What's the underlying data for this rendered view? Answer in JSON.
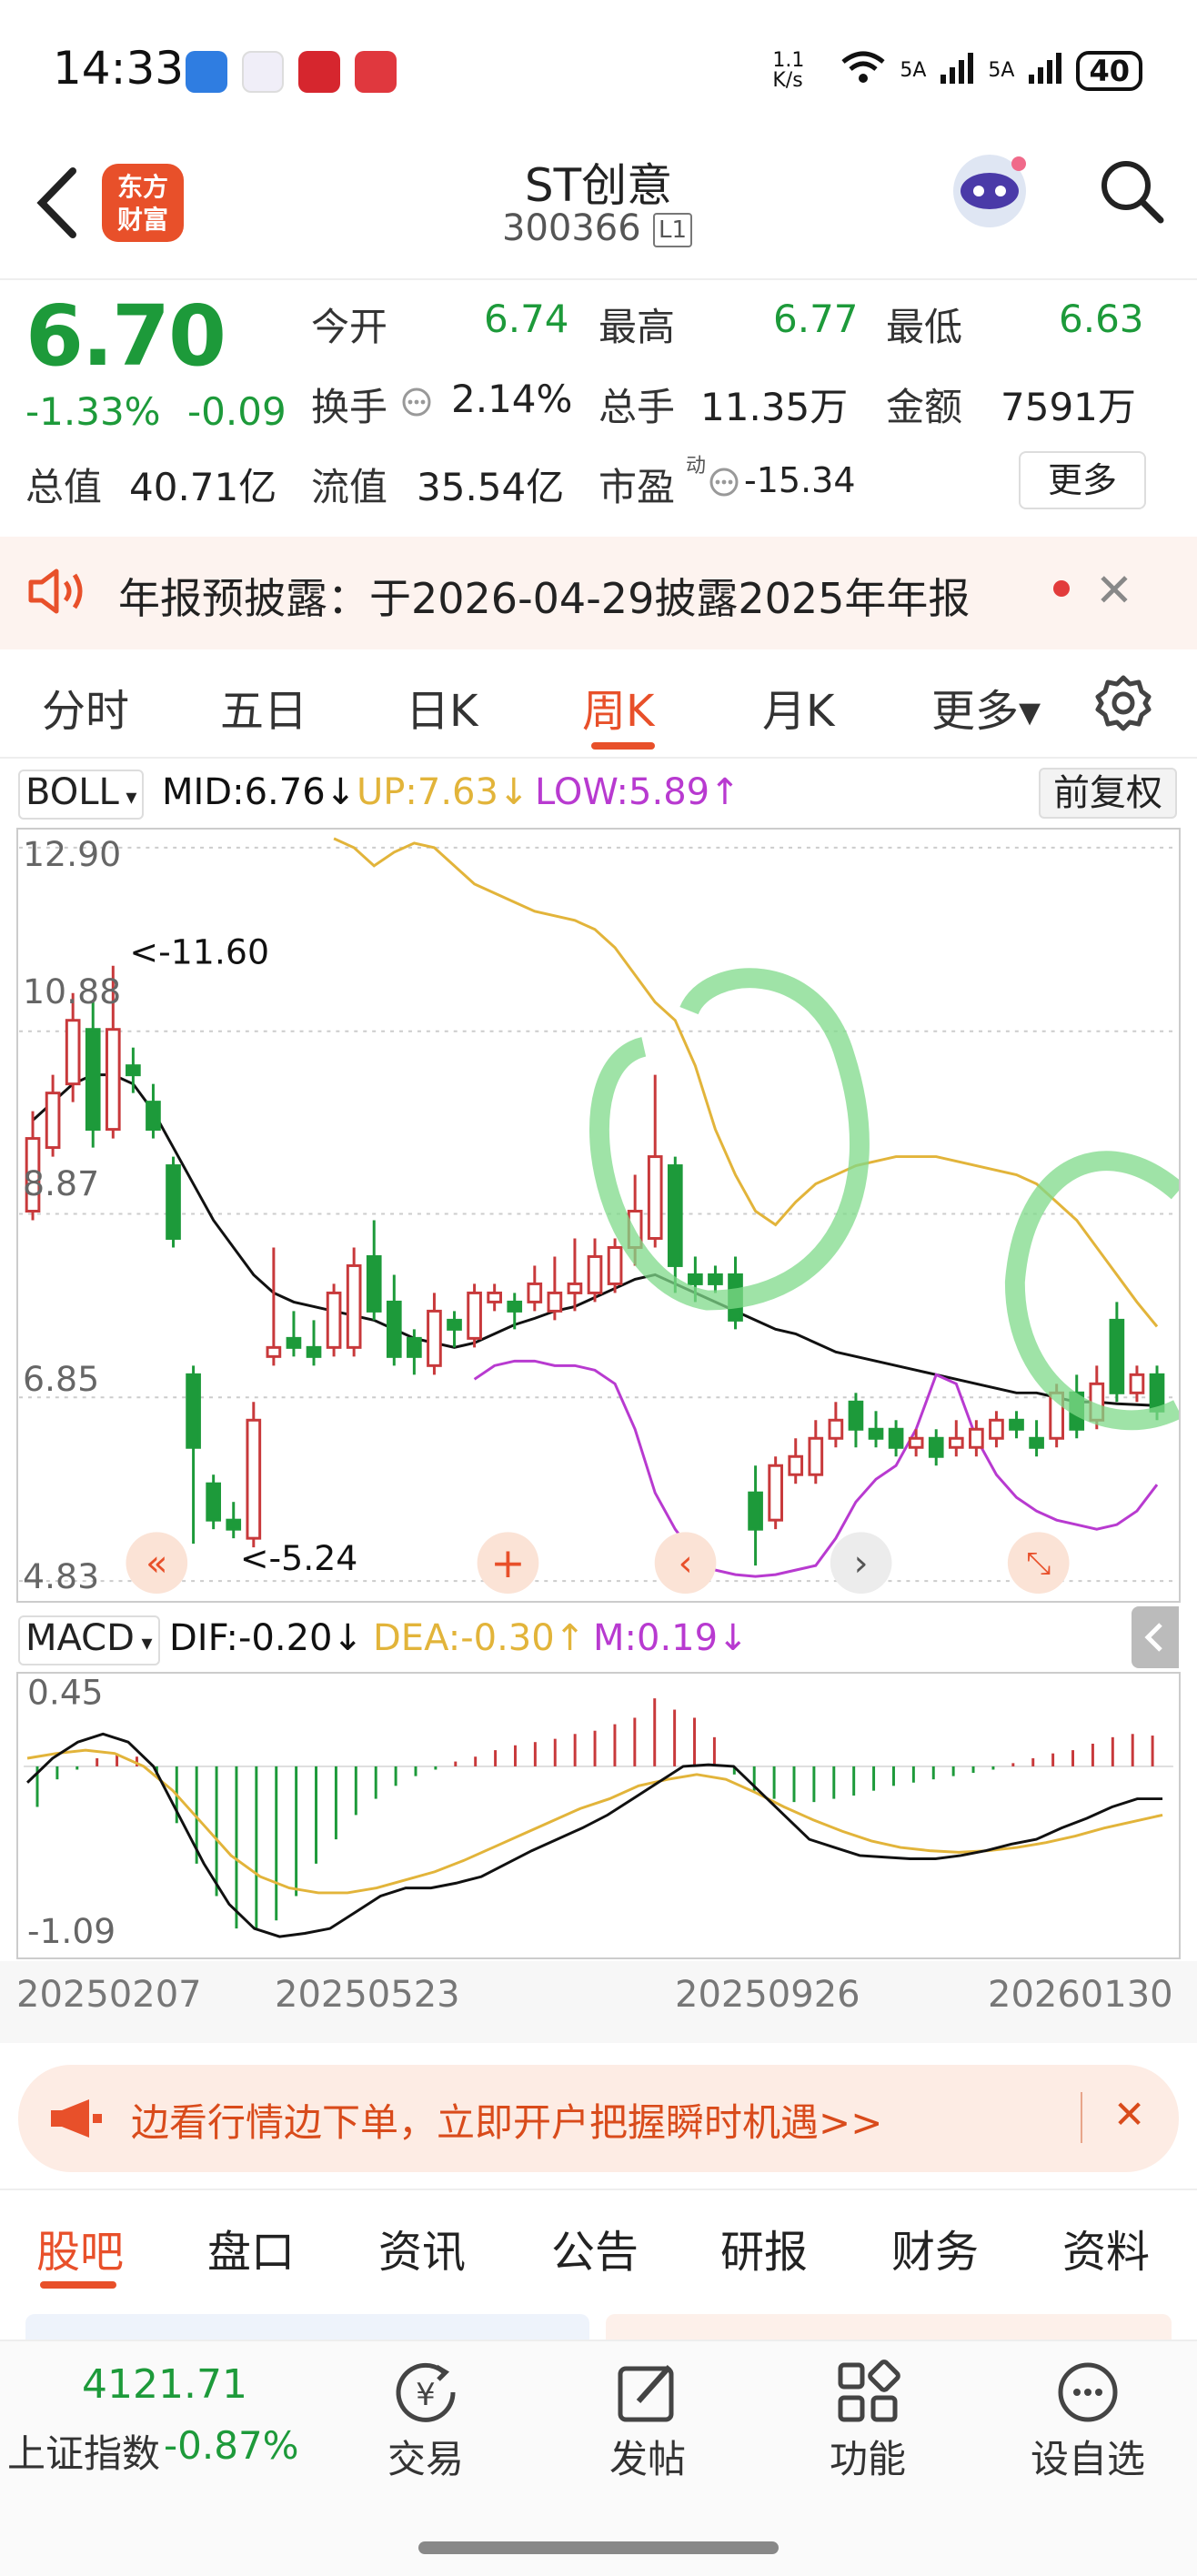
{
  "status_bar": {
    "time": "14:33",
    "net_speed": "1.1 K/s",
    "signal1": "5A",
    "signal2": "5A",
    "battery": "40"
  },
  "header": {
    "brand": [
      "东方",
      "财富"
    ],
    "stock_name": "ST创意",
    "stock_code": "300366",
    "code_badge": "L1"
  },
  "quote": {
    "price": "6.70",
    "change_pct": "-1.33%",
    "change": "-0.09",
    "open_label": "今开",
    "open": "6.74",
    "high_label": "最高",
    "high": "6.77",
    "low_label": "最低",
    "low": "6.63",
    "turnover_label": "换手",
    "turnover": "2.14%",
    "volume_label": "总手",
    "volume": "11.35万",
    "amount_label": "金额",
    "amount": "7591万",
    "mktcap_label": "总值",
    "mktcap": "40.71亿",
    "float_label": "流值",
    "float_cap": "35.54亿",
    "pe_label": "市盈",
    "pe_super": "动",
    "pe": "-15.34",
    "more_label": "更多"
  },
  "notice": {
    "text": "年报预披露：于2026-04-29披露2025年年报",
    "close": "✕"
  },
  "period_tabs": [
    {
      "label": "分时"
    },
    {
      "label": "五日"
    },
    {
      "label": "日K"
    },
    {
      "label": "周K"
    },
    {
      "label": "月K"
    },
    {
      "label": "更多▾"
    }
  ],
  "boll": {
    "selector": "BOLL",
    "mid": "MID:6.76↓",
    "up": "UP:7.63↓",
    "low": "LOW:5.89↑",
    "adjust": "前复权",
    "axis": [
      "12.90",
      "10.88",
      "8.87",
      "6.85",
      "4.83"
    ],
    "max_label": "<-11.60",
    "min_label": "<-5.24"
  },
  "macd": {
    "selector": "MACD",
    "dif": "DIF:-0.20↓",
    "dea": "DEA:-0.30↑",
    "m": "M:0.19↓",
    "axis": [
      "0.45",
      "-1.09"
    ],
    "dates": [
      "20250207",
      "20250523",
      "20250926",
      "20260130"
    ]
  },
  "colors": {
    "up": "#c8393b",
    "down": "#1d9a3a",
    "mid": "#111111",
    "upper": "#e2b43a",
    "lower": "#b83ad0",
    "accent": "#e8502a"
  },
  "promo": {
    "text": "边看行情边下单，立即开户把握瞬时机遇>>",
    "close": "✕"
  },
  "bottom_tabs": [
    {
      "label": "股吧"
    },
    {
      "label": "盘口"
    },
    {
      "label": "资讯"
    },
    {
      "label": "公告"
    },
    {
      "label": "研报"
    },
    {
      "label": "财务"
    },
    {
      "label": "资料"
    }
  ],
  "bottom_nav": {
    "index_value": "4121.71",
    "index_name": "上证指数",
    "index_change": "-0.87%",
    "items": [
      {
        "label": "交易",
        "icon": "trade-icon"
      },
      {
        "label": "发帖",
        "icon": "post-icon"
      },
      {
        "label": "功能",
        "icon": "apps-icon"
      },
      {
        "label": "设自选",
        "icon": "more-icon"
      }
    ]
  },
  "chart_data": [
    {
      "type": "candlestick",
      "title": "周K",
      "y_axis_ticks": [
        12.9,
        10.88,
        8.87,
        6.85,
        4.83
      ],
      "ylim": [
        4.83,
        12.9
      ],
      "indicator": "BOLL",
      "candles": [
        {
          "o": 8.9,
          "c": 9.7,
          "h": 10.0,
          "l": 8.8
        },
        {
          "o": 9.6,
          "c": 10.2,
          "h": 10.4,
          "l": 9.5
        },
        {
          "o": 10.3,
          "c": 11.0,
          "h": 11.3,
          "l": 10.1
        },
        {
          "o": 10.9,
          "c": 9.8,
          "h": 11.2,
          "l": 9.6
        },
        {
          "o": 9.8,
          "c": 10.9,
          "h": 11.6,
          "l": 9.7
        },
        {
          "o": 10.5,
          "c": 10.4,
          "h": 10.7,
          "l": 10.2
        },
        {
          "o": 10.1,
          "c": 9.8,
          "h": 10.3,
          "l": 9.7
        },
        {
          "o": 9.4,
          "c": 8.6,
          "h": 9.5,
          "l": 8.5
        },
        {
          "o": 7.1,
          "c": 6.3,
          "h": 7.2,
          "l": 5.24
        },
        {
          "o": 5.9,
          "c": 5.5,
          "h": 6.0,
          "l": 5.4
        },
        {
          "o": 5.5,
          "c": 5.4,
          "h": 5.7,
          "l": 5.3
        },
        {
          "o": 5.3,
          "c": 6.6,
          "h": 6.8,
          "l": 5.2
        },
        {
          "o": 7.3,
          "c": 7.4,
          "h": 8.5,
          "l": 7.2
        },
        {
          "o": 7.5,
          "c": 7.4,
          "h": 7.8,
          "l": 7.3
        },
        {
          "o": 7.4,
          "c": 7.3,
          "h": 7.7,
          "l": 7.2
        },
        {
          "o": 7.4,
          "c": 8.0,
          "h": 8.1,
          "l": 7.3
        },
        {
          "o": 7.4,
          "c": 8.3,
          "h": 8.5,
          "l": 7.3
        },
        {
          "o": 8.4,
          "c": 7.8,
          "h": 8.8,
          "l": 7.7
        },
        {
          "o": 7.9,
          "c": 7.3,
          "h": 8.2,
          "l": 7.2
        },
        {
          "o": 7.5,
          "c": 7.3,
          "h": 7.6,
          "l": 7.1
        },
        {
          "o": 7.2,
          "c": 7.8,
          "h": 8.0,
          "l": 7.1
        },
        {
          "o": 7.7,
          "c": 7.6,
          "h": 7.8,
          "l": 7.4
        },
        {
          "o": 7.5,
          "c": 8.0,
          "h": 8.1,
          "l": 7.4
        },
        {
          "o": 7.9,
          "c": 8.0,
          "h": 8.1,
          "l": 7.8
        },
        {
          "o": 7.9,
          "c": 7.8,
          "h": 8.0,
          "l": 7.6
        },
        {
          "o": 7.9,
          "c": 8.1,
          "h": 8.3,
          "l": 7.8
        },
        {
          "o": 7.8,
          "c": 8.0,
          "h": 8.4,
          "l": 7.7
        },
        {
          "o": 8.0,
          "c": 8.1,
          "h": 8.6,
          "l": 7.8
        },
        {
          "o": 8.0,
          "c": 8.4,
          "h": 8.6,
          "l": 7.9
        },
        {
          "o": 8.1,
          "c": 8.5,
          "h": 8.6,
          "l": 8.0
        },
        {
          "o": 8.5,
          "c": 8.9,
          "h": 9.3,
          "l": 8.3
        },
        {
          "o": 8.6,
          "c": 9.5,
          "h": 10.4,
          "l": 8.5
        },
        {
          "o": 9.4,
          "c": 8.3,
          "h": 9.5,
          "l": 8.0
        },
        {
          "o": 8.2,
          "c": 8.1,
          "h": 8.4,
          "l": 7.9
        },
        {
          "o": 8.2,
          "c": 8.1,
          "h": 8.3,
          "l": 8.0
        },
        {
          "o": 8.2,
          "c": 7.7,
          "h": 8.4,
          "l": 7.6
        },
        {
          "o": 5.8,
          "c": 5.4,
          "h": 6.1,
          "l": 5.0
        },
        {
          "o": 5.5,
          "c": 6.1,
          "h": 6.2,
          "l": 5.4
        },
        {
          "o": 6.0,
          "c": 6.2,
          "h": 6.4,
          "l": 5.9
        },
        {
          "o": 6.0,
          "c": 6.4,
          "h": 6.6,
          "l": 5.9
        },
        {
          "o": 6.4,
          "c": 6.6,
          "h": 6.8,
          "l": 6.3
        },
        {
          "o": 6.8,
          "c": 6.5,
          "h": 6.9,
          "l": 6.3
        },
        {
          "o": 6.5,
          "c": 6.4,
          "h": 6.7,
          "l": 6.3
        },
        {
          "o": 6.5,
          "c": 6.3,
          "h": 6.6,
          "l": 6.2
        },
        {
          "o": 6.3,
          "c": 6.4,
          "h": 6.5,
          "l": 6.2
        },
        {
          "o": 6.4,
          "c": 6.2,
          "h": 6.5,
          "l": 6.1
        },
        {
          "o": 6.3,
          "c": 6.4,
          "h": 6.6,
          "l": 6.2
        },
        {
          "o": 6.3,
          "c": 6.5,
          "h": 6.6,
          "l": 6.2
        },
        {
          "o": 6.4,
          "c": 6.6,
          "h": 6.7,
          "l": 6.3
        },
        {
          "o": 6.6,
          "c": 6.5,
          "h": 6.7,
          "l": 6.4
        },
        {
          "o": 6.4,
          "c": 6.3,
          "h": 6.6,
          "l": 6.2
        },
        {
          "o": 6.4,
          "c": 6.9,
          "h": 7.0,
          "l": 6.3
        },
        {
          "o": 6.9,
          "c": 6.5,
          "h": 7.1,
          "l": 6.4
        },
        {
          "o": 6.6,
          "c": 7.0,
          "h": 7.2,
          "l": 6.5
        },
        {
          "o": 7.7,
          "c": 6.9,
          "h": 7.9,
          "l": 6.8
        },
        {
          "o": 6.9,
          "c": 7.1,
          "h": 7.2,
          "l": 6.8
        },
        {
          "o": 7.1,
          "c": 6.7,
          "h": 7.2,
          "l": 6.6
        }
      ],
      "mid": [
        9.9,
        10.1,
        10.3,
        10.4,
        10.4,
        10.3,
        10.0,
        9.6,
        9.2,
        8.8,
        8.5,
        8.2,
        8.0,
        7.9,
        7.85,
        7.8,
        7.75,
        7.7,
        7.6,
        7.5,
        7.45,
        7.4,
        7.45,
        7.55,
        7.65,
        7.72,
        7.8,
        7.85,
        7.95,
        8.05,
        8.15,
        8.2,
        8.1,
        8.0,
        7.9,
        7.8,
        7.7,
        7.6,
        7.55,
        7.45,
        7.35,
        7.3,
        7.25,
        7.2,
        7.15,
        7.1,
        7.05,
        7.0,
        6.95,
        6.9,
        6.9,
        6.85,
        6.8,
        6.8,
        6.78,
        6.77,
        6.76
      ],
      "upper": [
        13.0,
        12.9,
        12.7,
        12.85,
        12.95,
        12.9,
        12.7,
        12.5,
        12.4,
        12.3,
        12.2,
        12.15,
        12.1,
        12.0,
        11.8,
        11.5,
        11.2,
        11.0,
        10.5,
        9.8,
        9.3,
        8.9,
        8.75,
        9.0,
        9.2,
        9.3,
        9.4,
        9.45,
        9.5,
        9.5,
        9.5,
        9.45,
        9.4,
        9.35,
        9.3,
        9.2,
        9.0,
        8.8,
        8.5,
        8.2,
        7.9,
        7.63
      ],
      "lower": [
        7.05,
        7.2,
        7.25,
        7.25,
        7.2,
        7.2,
        7.15,
        7.0,
        6.5,
        5.8,
        5.4,
        5.1,
        4.95,
        4.9,
        4.88,
        4.9,
        4.95,
        5.0,
        5.3,
        5.7,
        5.95,
        6.1,
        6.5,
        7.1,
        7.0,
        6.4,
        6.0,
        5.75,
        5.6,
        5.5,
        5.45,
        5.4,
        5.45,
        5.6,
        5.89
      ],
      "annotations": [
        "<-11.60",
        "<-5.24"
      ]
    },
    {
      "type": "bar",
      "title": "MACD",
      "y_axis_ticks": [
        0.45,
        -1.09
      ],
      "ylim": [
        -1.09,
        0.45
      ],
      "x_ticks": [
        "20250207",
        "20250523",
        "20250926",
        "20260130"
      ],
      "m": [
        -0.25,
        -0.08,
        -0.02,
        0.05,
        0.08,
        0.06,
        -0.05,
        -0.35,
        -0.6,
        -0.8,
        -1.0,
        -1.0,
        -0.95,
        -0.8,
        -0.6,
        -0.45,
        -0.3,
        -0.2,
        -0.12,
        -0.06,
        -0.02,
        0.03,
        0.06,
        0.1,
        0.13,
        0.15,
        0.17,
        0.2,
        0.22,
        0.26,
        0.3,
        0.42,
        0.35,
        0.3,
        0.18,
        -0.05,
        -0.15,
        -0.2,
        -0.22,
        -0.22,
        -0.2,
        -0.18,
        -0.15,
        -0.12,
        -0.1,
        -0.08,
        -0.06,
        -0.04,
        -0.02,
        0.02,
        0.05,
        0.08,
        0.1,
        0.14,
        0.18,
        0.2,
        0.19
      ],
      "dif": [
        -0.1,
        0.05,
        0.15,
        0.2,
        0.15,
        0.0,
        -0.3,
        -0.6,
        -0.85,
        -1.0,
        -1.05,
        -1.03,
        -1.0,
        -0.9,
        -0.8,
        -0.75,
        -0.75,
        -0.72,
        -0.68,
        -0.6,
        -0.52,
        -0.45,
        -0.38,
        -0.3,
        -0.2,
        -0.1,
        0.0,
        0.01,
        0.0,
        -0.15,
        -0.3,
        -0.45,
        -0.5,
        -0.55,
        -0.56,
        -0.57,
        -0.57,
        -0.55,
        -0.52,
        -0.48,
        -0.45,
        -0.38,
        -0.32,
        -0.25,
        -0.2,
        -0.2
      ],
      "dea": [
        0.05,
        0.08,
        0.1,
        0.08,
        0.0,
        -0.15,
        -0.35,
        -0.55,
        -0.68,
        -0.75,
        -0.78,
        -0.78,
        -0.75,
        -0.7,
        -0.65,
        -0.58,
        -0.5,
        -0.42,
        -0.34,
        -0.26,
        -0.2,
        -0.12,
        -0.08,
        -0.05,
        -0.08,
        -0.16,
        -0.25,
        -0.33,
        -0.4,
        -0.46,
        -0.5,
        -0.52,
        -0.53,
        -0.52,
        -0.5,
        -0.47,
        -0.43,
        -0.38,
        -0.34,
        -0.3
      ]
    }
  ]
}
